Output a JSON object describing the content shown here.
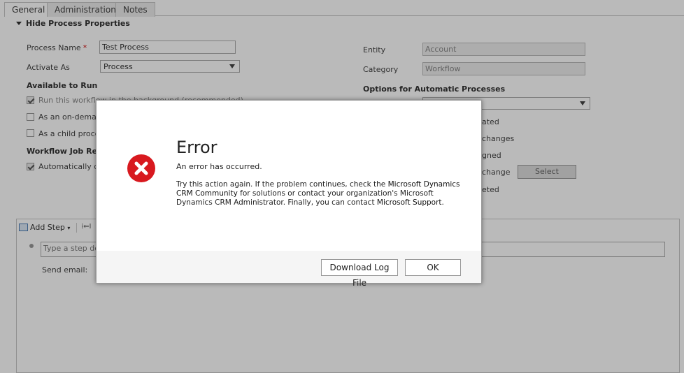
{
  "tabs": [
    {
      "label": "General"
    },
    {
      "label": "Administration"
    },
    {
      "label": "Notes"
    }
  ],
  "section": {
    "label": "Hide Process Properties"
  },
  "form": {
    "process_name_label": "Process Name",
    "required_mark": "*",
    "process_name_value": "Test Process",
    "activate_as_label": "Activate As",
    "activate_as_value": "Process",
    "entity_label": "Entity",
    "entity_value": "Account",
    "category_label": "Category",
    "category_value": "Workflow",
    "available_to_run_heading": "Available to Run",
    "options_heading": "Options for Automatic Processes",
    "job_retention_heading": "Workflow Job Rete",
    "run_background_label": "Run this workflow in the background (recommended)",
    "on_demand_label": "As an on-demar",
    "child_process_label": "As a child proce",
    "auto_delete_label": "Automatically de",
    "opt_created": "ated",
    "opt_changes": "changes",
    "opt_assigned": "gned",
    "opt_change": "change",
    "opt_deleted": "eted",
    "select_button": "Select"
  },
  "steps": {
    "add_step_label": "Add Step",
    "placeholder": "Type a step de",
    "send_email_label": "Send email:"
  },
  "dialog": {
    "title": "Error",
    "message": "An error has occurred.",
    "detail_part1": "Try this action again. If the problem continues, check the ",
    "link_community": "Microsoft Dynamics CRM Community",
    "detail_part2": " for solutions or contact your organization's Microsoft Dynamics CRM Administrator. Finally, you can contact ",
    "link_support": "Microsoft Support",
    "detail_part3": ".",
    "download_button": "Download Log File",
    "ok_button": "OK"
  },
  "colors": {
    "error_red": "#d8191f",
    "overlay": "rgba(0,0,0,0.27)"
  }
}
